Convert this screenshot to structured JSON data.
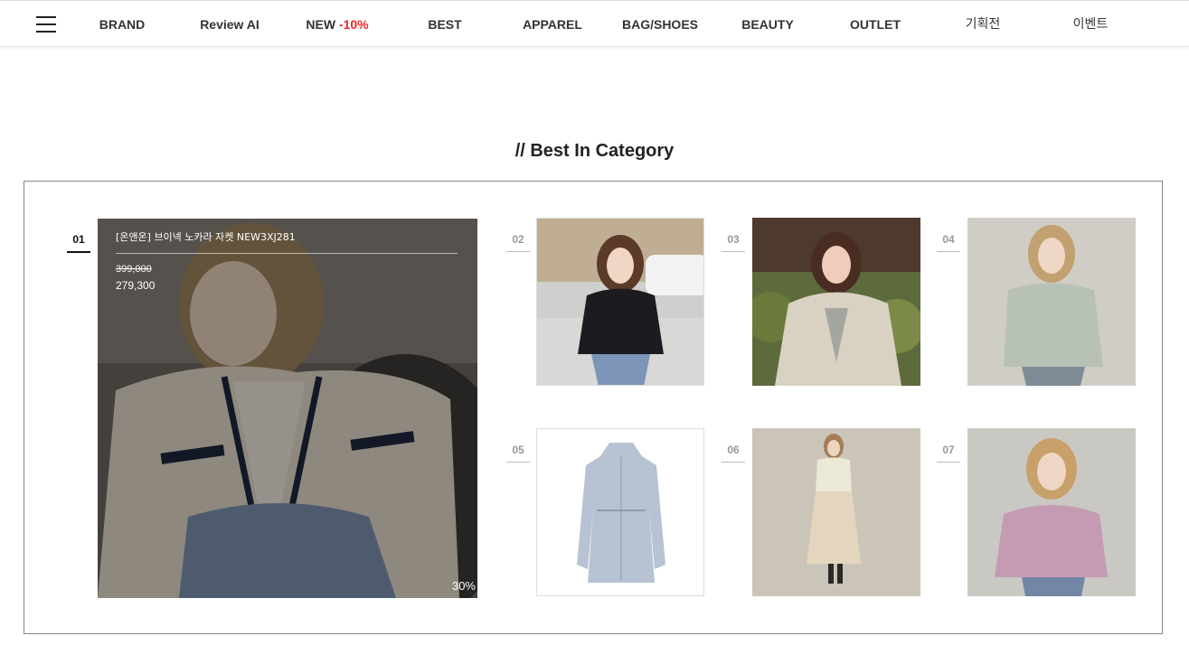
{
  "nav": {
    "items": [
      {
        "label": "BRAND"
      },
      {
        "label": "Review AI"
      },
      {
        "label": "NEW",
        "badge": "-10%"
      },
      {
        "label": "BEST"
      },
      {
        "label": "APPAREL"
      },
      {
        "label": "BAG/SHOES"
      },
      {
        "label": "BEAUTY"
      },
      {
        "label": "OUTLET"
      },
      {
        "label": "기획전"
      },
      {
        "label": "이벤트"
      }
    ]
  },
  "section": {
    "title": "// Best In Category"
  },
  "products": [
    {
      "rank": "01",
      "name": "[온앤온] 브이넥 노카라 자켓 NEW3XJ281",
      "original_price": "399,000",
      "sale_price": "279,300",
      "discount": "30%"
    },
    {
      "rank": "02"
    },
    {
      "rank": "03"
    },
    {
      "rank": "04"
    },
    {
      "rank": "05"
    },
    {
      "rank": "06"
    },
    {
      "rank": "07"
    }
  ],
  "colors": {
    "accent_red": "#e8272e",
    "text_dark": "#222222"
  }
}
